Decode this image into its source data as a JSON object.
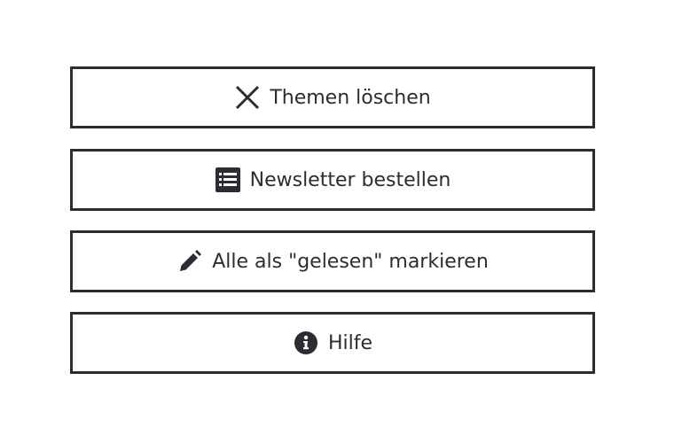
{
  "buttons": [
    {
      "label": "Themen löschen",
      "icon": "close-icon"
    },
    {
      "label": "Newsletter bestellen",
      "icon": "list-icon"
    },
    {
      "label": "Alle als \"gelesen\" markieren",
      "icon": "pencil-icon"
    },
    {
      "label": "Hilfe",
      "icon": "info-icon"
    }
  ],
  "colors": {
    "border": "#2b2d33",
    "text": "#2b2d33",
    "background": "#ffffff"
  }
}
